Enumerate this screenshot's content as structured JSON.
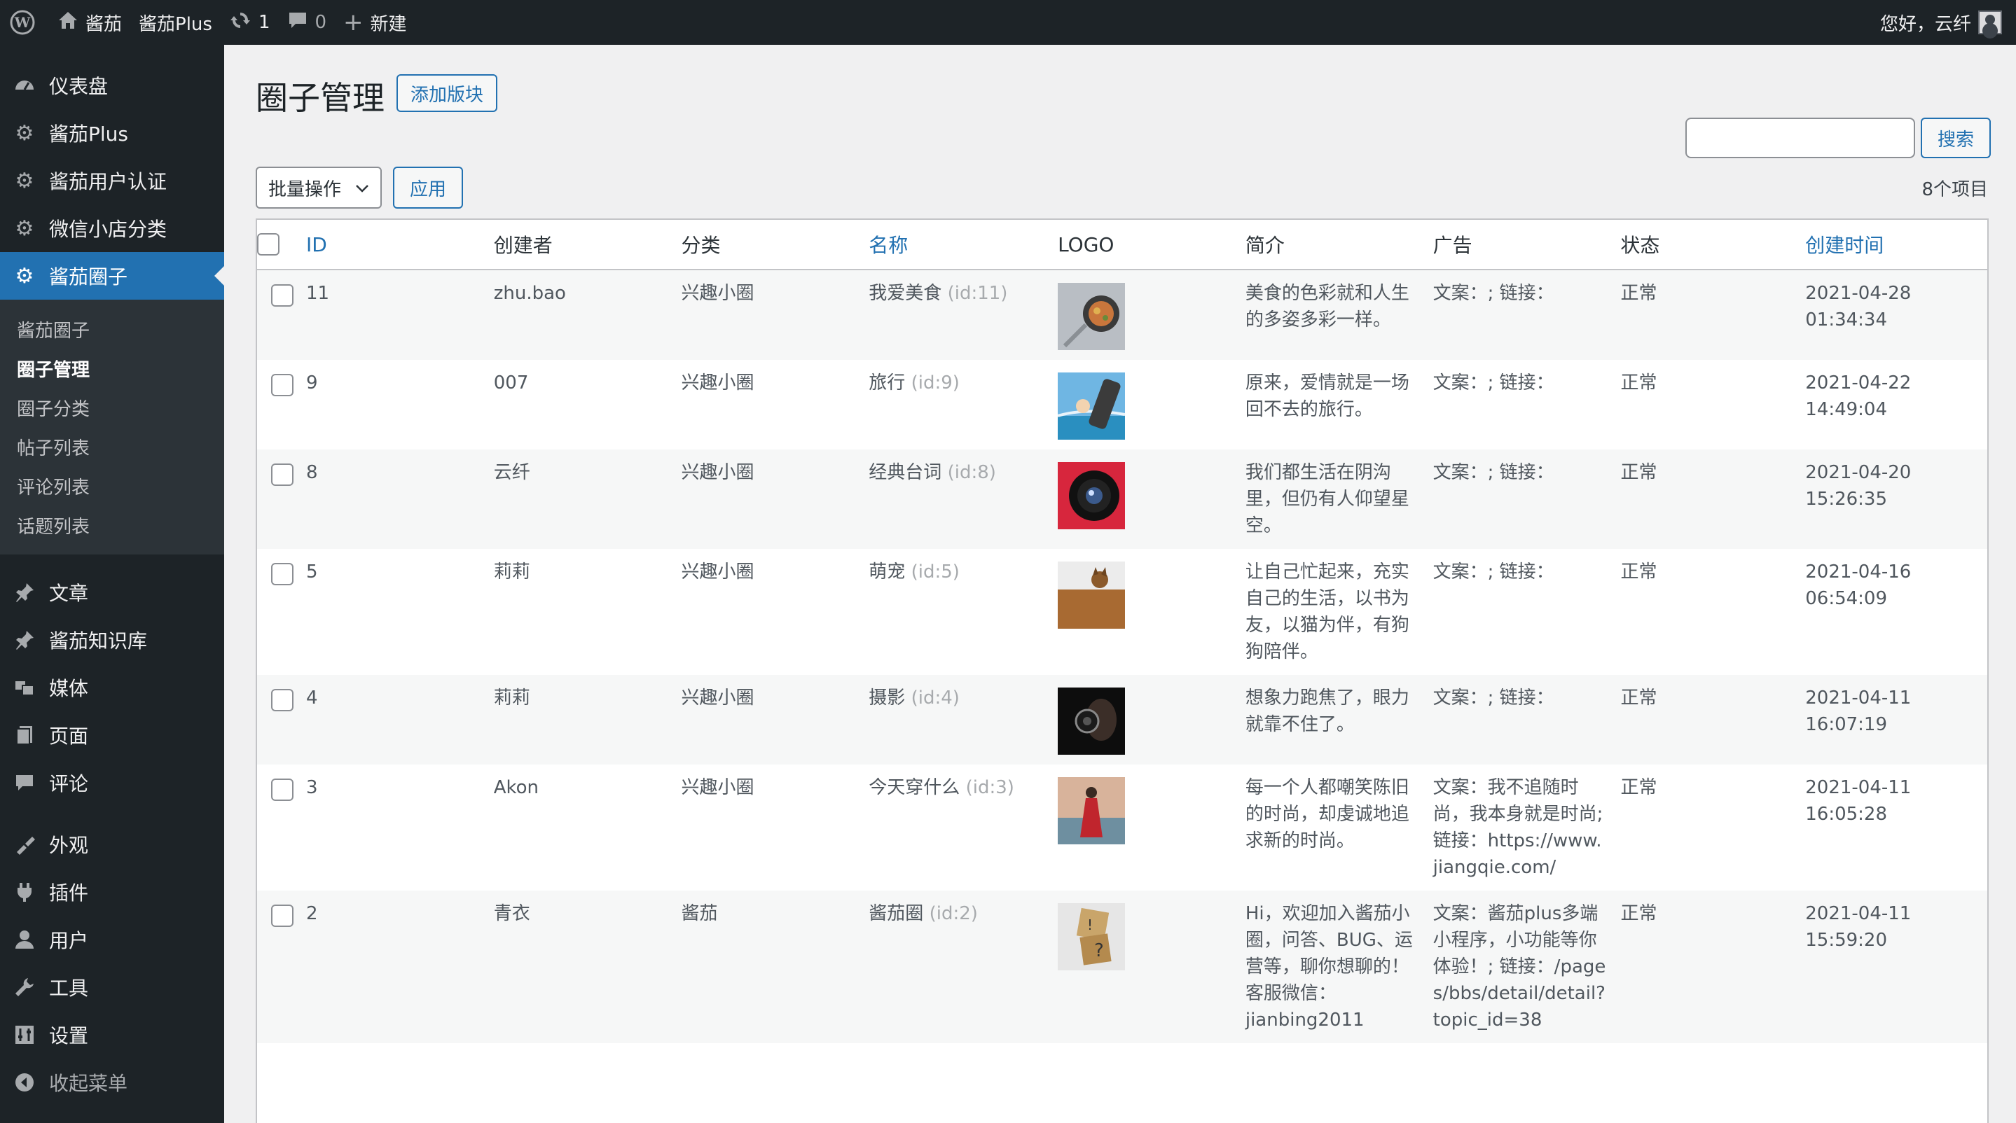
{
  "adminbar": {
    "site_name": "酱茄",
    "plugin": "酱茄Plus",
    "updates_count": "1",
    "comments_count": "0",
    "new_label": "新建",
    "greeting": "您好，云纤"
  },
  "sidebar": {
    "top_items": [
      {
        "label": "仪表盘",
        "icon": "dashboard-icon"
      },
      {
        "label": "酱茄Plus",
        "icon": "gear-icon"
      },
      {
        "label": "酱茄用户认证",
        "icon": "gear-icon"
      },
      {
        "label": "微信小店分类",
        "icon": "gear-icon"
      },
      {
        "label": "酱茄圈子",
        "icon": "gear-icon"
      }
    ],
    "submenu": [
      "酱茄圈子",
      "圈子管理",
      "圈子分类",
      "帖子列表",
      "评论列表",
      "话题列表"
    ],
    "items": [
      {
        "label": "文章",
        "icon": "pin-icon"
      },
      {
        "label": "酱茄知识库",
        "icon": "pin-icon"
      },
      {
        "label": "媒体",
        "icon": "media-icon"
      },
      {
        "label": "页面",
        "icon": "page-icon"
      },
      {
        "label": "评论",
        "icon": "comment-icon"
      },
      {
        "label": "外观",
        "icon": "appearance-icon"
      },
      {
        "label": "插件",
        "icon": "plugin-icon"
      },
      {
        "label": "用户",
        "icon": "user-icon"
      },
      {
        "label": "工具",
        "icon": "wrench-icon"
      },
      {
        "label": "设置",
        "icon": "settings-icon"
      },
      {
        "label": "收起菜单",
        "icon": "collapse-icon"
      }
    ]
  },
  "page": {
    "title": "圈子管理",
    "add_button": "添加版块",
    "search_button": "搜索",
    "bulk_actions": "批量操作",
    "apply": "应用",
    "item_count": "8个项目"
  },
  "table": {
    "headers": [
      "ID",
      "创建者",
      "分类",
      "名称",
      "LOGO",
      "简介",
      "广告",
      "状态",
      "创建时间"
    ],
    "rows": [
      {
        "id": "11",
        "author": "zhu.bao",
        "category": "兴趣小圈",
        "name": "我爱美食",
        "name_id": "(id:11)",
        "logo": "food",
        "desc": "美食的色彩就和人生的多姿多彩一样。",
        "ad": "文案：; 链接：",
        "status": "正常",
        "date": "2021-04-28",
        "time": "01:34:34"
      },
      {
        "id": "9",
        "author": "007",
        "category": "兴趣小圈",
        "name": "旅行",
        "name_id": "(id:9)",
        "logo": "travel",
        "desc": "原来，爱情就是一场回不去的旅行。",
        "ad": "文案：; 链接：",
        "status": "正常",
        "date": "2021-04-22",
        "time": "14:49:04"
      },
      {
        "id": "8",
        "author": "云纤",
        "category": "兴趣小圈",
        "name": "经典台词",
        "name_id": "(id:8)",
        "logo": "lens",
        "desc": "我们都生活在阴沟里，但仍有人仰望星空。",
        "ad": "文案：; 链接：",
        "status": "正常",
        "date": "2021-04-20",
        "time": "15:26:35"
      },
      {
        "id": "5",
        "author": "莉莉",
        "category": "兴趣小圈",
        "name": "萌宠",
        "name_id": "(id:5)",
        "logo": "pet",
        "desc": "让自己忙起来，充实自己的生活，以书为友，以猫为伴，有狗狗陪伴。",
        "ad": "文案：; 链接：",
        "status": "正常",
        "date": "2021-04-16",
        "time": "06:54:09"
      },
      {
        "id": "4",
        "author": "莉莉",
        "category": "兴趣小圈",
        "name": "摄影",
        "name_id": "(id:4)",
        "logo": "photo",
        "desc": "想象力跑焦了，眼力就靠不住了。",
        "ad": "文案：; 链接：",
        "status": "正常",
        "date": "2021-04-11",
        "time": "16:07:19"
      },
      {
        "id": "3",
        "author": "Akon",
        "category": "兴趣小圈",
        "name": "今天穿什么",
        "name_id": "(id:3)",
        "logo": "fashion",
        "desc": "每一个人都嘲笑陈旧的时尚，却虔诚地追求新的时尚。",
        "ad": "文案：我不追随时尚，我本身就是时尚; 链接：https://www.jiangqie.com/",
        "status": "正常",
        "date": "2021-04-11",
        "time": "16:05:28"
      },
      {
        "id": "2",
        "author": "青衣",
        "category": "酱茄",
        "name": "酱茄圈",
        "name_id": "(id:2)",
        "logo": "dice",
        "desc": "Hi，欢迎加入酱茄小圈，问答、BUG、运营等，聊你想聊的！客服微信：jianbing2011",
        "ad": "文案：酱茄plus多端小程序，小功能等你体验！; 链接：/pages/bbs/detail/detail?topic_id=38",
        "status": "正常",
        "date": "2021-04-11",
        "time": "15:59:20"
      }
    ]
  }
}
